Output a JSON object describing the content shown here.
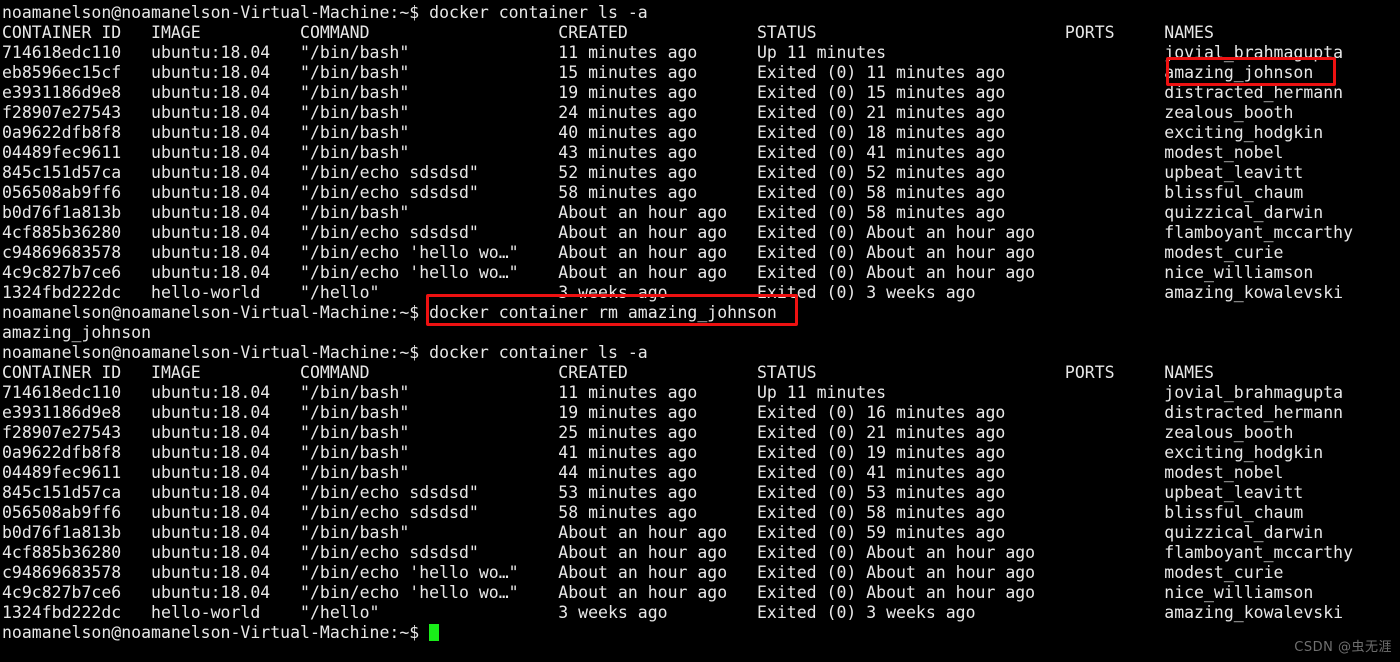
{
  "terminal": {
    "title": "noamanelson@noamanelson-Virtual-Machine: ~",
    "prompt": "noamanelson@noamanelson-Virtual-Machine:~$ ",
    "background_color": "#000000",
    "foreground_color": "#e8e8e8",
    "cursor_color": "#19ed19",
    "highlight_color": "#ee1111",
    "columns": 140,
    "rows": 33
  },
  "commands": {
    "list_all": "docker container ls -a",
    "remove_container": "docker container rm amazing_johnson",
    "removed_output": "amazing_johnson"
  },
  "table_headers": {
    "container_id": "CONTAINER ID",
    "image": "IMAGE",
    "command": "COMMAND",
    "created": "CREATED",
    "status": "STATUS",
    "ports": "PORTS",
    "names": "NAMES"
  },
  "listing_before": [
    {
      "id": "714618edc110",
      "image": "ubuntu:18.04",
      "command": "\"/bin/bash\"",
      "created": "11 minutes ago",
      "status": "Up 11 minutes",
      "ports": "",
      "name": "jovial_brahmagupta"
    },
    {
      "id": "eb8596ec15cf",
      "image": "ubuntu:18.04",
      "command": "\"/bin/bash\"",
      "created": "15 minutes ago",
      "status": "Exited (0) 11 minutes ago",
      "ports": "",
      "name": "amazing_johnson"
    },
    {
      "id": "e3931186d9e8",
      "image": "ubuntu:18.04",
      "command": "\"/bin/bash\"",
      "created": "19 minutes ago",
      "status": "Exited (0) 15 minutes ago",
      "ports": "",
      "name": "distracted_hermann"
    },
    {
      "id": "f28907e27543",
      "image": "ubuntu:18.04",
      "command": "\"/bin/bash\"",
      "created": "24 minutes ago",
      "status": "Exited (0) 21 minutes ago",
      "ports": "",
      "name": "zealous_booth"
    },
    {
      "id": "0a9622dfb8f8",
      "image": "ubuntu:18.04",
      "command": "\"/bin/bash\"",
      "created": "40 minutes ago",
      "status": "Exited (0) 18 minutes ago",
      "ports": "",
      "name": "exciting_hodgkin"
    },
    {
      "id": "04489fec9611",
      "image": "ubuntu:18.04",
      "command": "\"/bin/bash\"",
      "created": "43 minutes ago",
      "status": "Exited (0) 41 minutes ago",
      "ports": "",
      "name": "modest_nobel"
    },
    {
      "id": "845c151d57ca",
      "image": "ubuntu:18.04",
      "command": "\"/bin/echo sdsdsd\"",
      "created": "52 minutes ago",
      "status": "Exited (0) 52 minutes ago",
      "ports": "",
      "name": "upbeat_leavitt"
    },
    {
      "id": "056508ab9ff6",
      "image": "ubuntu:18.04",
      "command": "\"/bin/echo sdsdsd\"",
      "created": "58 minutes ago",
      "status": "Exited (0) 58 minutes ago",
      "ports": "",
      "name": "blissful_chaum"
    },
    {
      "id": "b0d76f1a813b",
      "image": "ubuntu:18.04",
      "command": "\"/bin/bash\"",
      "created": "About an hour ago",
      "status": "Exited (0) 58 minutes ago",
      "ports": "",
      "name": "quizzical_darwin"
    },
    {
      "id": "4cf885b36280",
      "image": "ubuntu:18.04",
      "command": "\"/bin/echo sdsdsd\"",
      "created": "About an hour ago",
      "status": "Exited (0) About an hour ago",
      "ports": "",
      "name": "flamboyant_mccarthy"
    },
    {
      "id": "c94869683578",
      "image": "ubuntu:18.04",
      "command": "\"/bin/echo 'hello wo…\"",
      "created": "About an hour ago",
      "status": "Exited (0) About an hour ago",
      "ports": "",
      "name": "modest_curie"
    },
    {
      "id": "4c9c827b7ce6",
      "image": "ubuntu:18.04",
      "command": "\"/bin/echo 'hello wo…\"",
      "created": "About an hour ago",
      "status": "Exited (0) About an hour ago",
      "ports": "",
      "name": "nice_williamson"
    },
    {
      "id": "1324fbd222dc",
      "image": "hello-world",
      "command": "\"/hello\"",
      "created": "3 weeks ago",
      "status": "Exited (0) 3 weeks ago",
      "ports": "",
      "name": "amazing_kowalevski"
    }
  ],
  "listing_after": [
    {
      "id": "714618edc110",
      "image": "ubuntu:18.04",
      "command": "\"/bin/bash\"",
      "created": "11 minutes ago",
      "status": "Up 11 minutes",
      "ports": "",
      "name": "jovial_brahmagupta"
    },
    {
      "id": "e3931186d9e8",
      "image": "ubuntu:18.04",
      "command": "\"/bin/bash\"",
      "created": "19 minutes ago",
      "status": "Exited (0) 16 minutes ago",
      "ports": "",
      "name": "distracted_hermann"
    },
    {
      "id": "f28907e27543",
      "image": "ubuntu:18.04",
      "command": "\"/bin/bash\"",
      "created": "25 minutes ago",
      "status": "Exited (0) 21 minutes ago",
      "ports": "",
      "name": "zealous_booth"
    },
    {
      "id": "0a9622dfb8f8",
      "image": "ubuntu:18.04",
      "command": "\"/bin/bash\"",
      "created": "41 minutes ago",
      "status": "Exited (0) 19 minutes ago",
      "ports": "",
      "name": "exciting_hodgkin"
    },
    {
      "id": "04489fec9611",
      "image": "ubuntu:18.04",
      "command": "\"/bin/bash\"",
      "created": "44 minutes ago",
      "status": "Exited (0) 41 minutes ago",
      "ports": "",
      "name": "modest_nobel"
    },
    {
      "id": "845c151d57ca",
      "image": "ubuntu:18.04",
      "command": "\"/bin/echo sdsdsd\"",
      "created": "53 minutes ago",
      "status": "Exited (0) 53 minutes ago",
      "ports": "",
      "name": "upbeat_leavitt"
    },
    {
      "id": "056508ab9ff6",
      "image": "ubuntu:18.04",
      "command": "\"/bin/echo sdsdsd\"",
      "created": "58 minutes ago",
      "status": "Exited (0) 58 minutes ago",
      "ports": "",
      "name": "blissful_chaum"
    },
    {
      "id": "b0d76f1a813b",
      "image": "ubuntu:18.04",
      "command": "\"/bin/bash\"",
      "created": "About an hour ago",
      "status": "Exited (0) 59 minutes ago",
      "ports": "",
      "name": "quizzical_darwin"
    },
    {
      "id": "4cf885b36280",
      "image": "ubuntu:18.04",
      "command": "\"/bin/echo sdsdsd\"",
      "created": "About an hour ago",
      "status": "Exited (0) About an hour ago",
      "ports": "",
      "name": "flamboyant_mccarthy"
    },
    {
      "id": "c94869683578",
      "image": "ubuntu:18.04",
      "command": "\"/bin/echo 'hello wo…\"",
      "created": "About an hour ago",
      "status": "Exited (0) About an hour ago",
      "ports": "",
      "name": "modest_curie"
    },
    {
      "id": "4c9c827b7ce6",
      "image": "ubuntu:18.04",
      "command": "\"/bin/echo 'hello wo…\"",
      "created": "About an hour ago",
      "status": "Exited (0) About an hour ago",
      "ports": "",
      "name": "nice_williamson"
    },
    {
      "id": "1324fbd222dc",
      "image": "hello-world",
      "command": "\"/hello\"",
      "created": "3 weeks ago",
      "status": "Exited (0) 3 weeks ago",
      "ports": "",
      "name": "amazing_kowalevski"
    }
  ],
  "watermark": "CSDN @虫无涯"
}
